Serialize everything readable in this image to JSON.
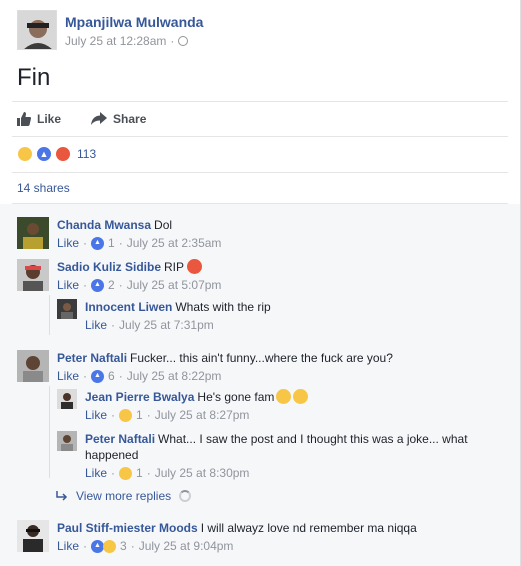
{
  "post": {
    "author": "Mpanjilwa Mulwanda",
    "time": "July 25 at 12:28am",
    "separator": "·",
    "text": "Fin",
    "like_label": "Like",
    "share_label": "Share",
    "reaction_count": "113",
    "shares": "14 shares",
    "reaction_icons": [
      "sad-icon",
      "like-icon",
      "angry-icon"
    ]
  },
  "comments": [
    {
      "name": "Chanda Mwansa",
      "text": "Dol",
      "like": "Like",
      "sep1": "·",
      "likes": "1",
      "sep2": "·",
      "time": "July 25 at 2:35am"
    },
    {
      "name": "Sadio Kuliz Sidibe",
      "text": "RIP",
      "like": "Like",
      "sep1": "·",
      "likes": "2",
      "sep2": "·",
      "time": "July 25 at 5:07pm"
    },
    {
      "name": "Innocent Liwen",
      "text": "Whats with the rip",
      "like": "Like",
      "sep2": "·",
      "time": "July 25 at 7:31pm"
    },
    {
      "name": "Peter Naftali",
      "text": "Fucker... this ain't funny...where the fuck are you?",
      "like": "Like",
      "sep1": "·",
      "likes": "6",
      "sep2": "·",
      "time": "July 25 at 8:22pm"
    },
    {
      "name": "Jean Pierre Bwalya",
      "text": "He's gone fam",
      "like": "Like",
      "sep1": "·",
      "likes": "1",
      "sep2": "·",
      "time": "July 25 at 8:27pm"
    },
    {
      "name": "Peter Naftali",
      "text": "What... I saw the post and I thought this was a joke... what happened",
      "like": "Like",
      "sep1": "·",
      "likes": "1",
      "sep2": "·",
      "time": "July 25 at 8:30pm"
    },
    {
      "name": "Paul Stiff-miester Moods",
      "text": "I will alwayz love nd remember ma niqqa",
      "like": "Like",
      "sep1": "·",
      "likes": "3",
      "sep2": "·",
      "time": "July 25 at 9:04pm"
    }
  ],
  "view_more_replies": "View more replies",
  "colors": {
    "link": "#365899",
    "meta": "#90949c",
    "like_blue": "#4a76e8",
    "sad_yellow": "#f7c646",
    "angry_red": "#e9573f"
  }
}
